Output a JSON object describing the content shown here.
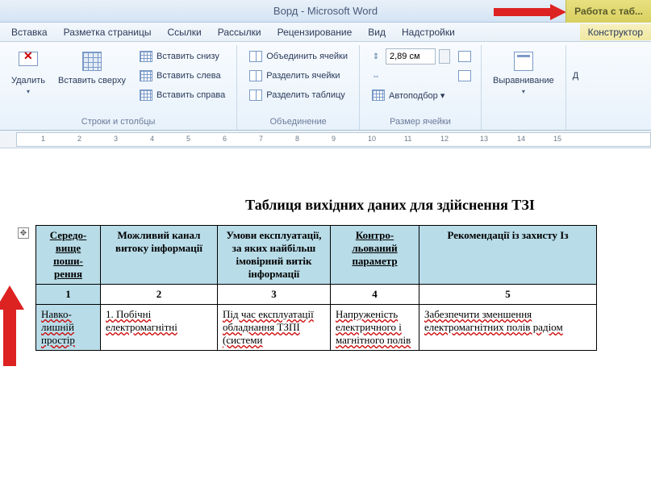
{
  "title": "Ворд - Microsoft Word",
  "contextual_tab": "Работа с таб...",
  "menu": {
    "items": [
      "Вставка",
      "Разметка страницы",
      "Ссылки",
      "Рассылки",
      "Рецензирование",
      "Вид",
      "Надстройки"
    ],
    "right": "Конструктор"
  },
  "ribbon": {
    "group1": {
      "label": "",
      "delete": "Удалить",
      "insert_above": "Вставить сверху",
      "insert_below": "Вставить снизу",
      "insert_left": "Вставить слева",
      "insert_right": "Вставить справа",
      "group_label": "Строки и столбцы"
    },
    "group2": {
      "merge": "Объединить ячейки",
      "split_cells": "Разделить ячейки",
      "split_table": "Разделить таблицу",
      "group_label": "Объединение"
    },
    "group3": {
      "height_value": "2,89 см",
      "autofit": "Автоподбор",
      "group_label": "Размер ячейки"
    },
    "group4": {
      "alignment": "Выравнивание",
      "group_label": ""
    },
    "group5": {
      "data_label": "Д"
    }
  },
  "ruler": {
    "ticks": [
      "1",
      "2",
      "3",
      "4",
      "5",
      "6",
      "7",
      "8",
      "9",
      "10",
      "11",
      "12",
      "13",
      "14",
      "15"
    ]
  },
  "document": {
    "title": "Таблиця вихідних даних для здійснення ТЗІ",
    "headers": [
      "Середо-вище поши-рення",
      "Можливий канал витоку інформації",
      "Умови експлуатації, за яких найбільш імовірний витік інформації",
      "Контро-льований параметр",
      "Рекомендації із захисту Із"
    ],
    "numbers": [
      "1",
      "2",
      "3",
      "4",
      "5"
    ],
    "row1": [
      "Навко-лишній простір",
      "1. Побічні електромагнітні",
      "Під час експлуатації обладнання ТЗПІ (системи",
      "Напруженість електричного і магнітного полів",
      "Забезпечити зменшення електромагнітних полів радіом"
    ]
  }
}
